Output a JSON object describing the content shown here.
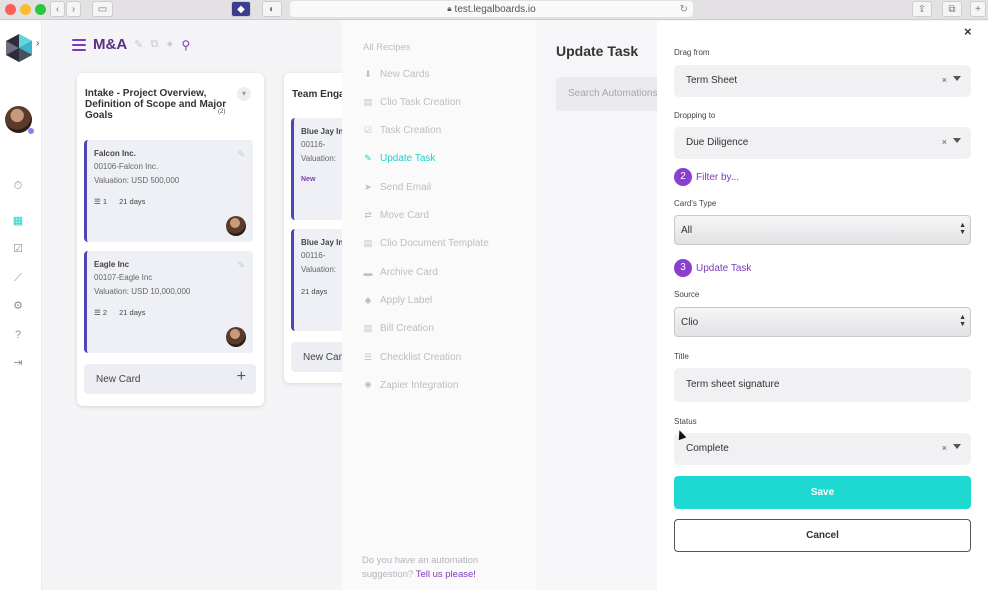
{
  "browser": {
    "url": "test.legalboards.io"
  },
  "board": {
    "title": "M&A",
    "columns": [
      {
        "title": "Intake - Project Overview, Definition of Scope and Major Goals",
        "count": "(2)",
        "cards": [
          {
            "name": "Falcon Inc.",
            "number": "00106-Falcon Inc.",
            "valuation": "Valuation: USD 500,000",
            "tasks": "1",
            "days": "21 days"
          },
          {
            "name": "Eagle Inc",
            "number": "00107-Eagle Inc",
            "valuation": "Valuation: USD 10,000,000",
            "tasks": "2",
            "days": "21 days"
          }
        ],
        "new_card": "New Card"
      },
      {
        "title": "Team Enga",
        "cards": [
          {
            "name": "Blue Jay In",
            "number": "00116-",
            "valuation": "Valuation:",
            "tag": "New"
          },
          {
            "name": "Blue Jay In",
            "number": "00116-",
            "valuation": "Valuation:",
            "days": "21 days"
          }
        ],
        "new_card": "New Car"
      }
    ]
  },
  "recipes": {
    "header": "All Recipes",
    "items": [
      {
        "label": "New Cards",
        "icon": "download-icon"
      },
      {
        "label": "Clio Task Creation",
        "icon": "document-icon"
      },
      {
        "label": "Task Creation",
        "icon": "checkbox-icon"
      },
      {
        "label": "Update Task",
        "icon": "pencil-icon",
        "active": true
      },
      {
        "label": "Send Email",
        "icon": "send-icon"
      },
      {
        "label": "Move Card",
        "icon": "arrows-icon"
      },
      {
        "label": "Clio Document Template",
        "icon": "document-icon"
      },
      {
        "label": "Archive Card",
        "icon": "archive-icon"
      },
      {
        "label": "Apply Label",
        "icon": "tags-icon"
      },
      {
        "label": "Bill Creation",
        "icon": "document-icon"
      },
      {
        "label": "Checklist Creation",
        "icon": "list-icon"
      },
      {
        "label": "Zapier Integration",
        "icon": "sun-icon"
      }
    ],
    "footer_text": "Do you have an automation suggestion?",
    "footer_link": "Tell us please!"
  },
  "middle": {
    "title": "Update Task",
    "search_placeholder": "Search Automations"
  },
  "form": {
    "drag_from_label": "Drag from",
    "drag_from_value": "Term Sheet",
    "dropping_to_label": "Dropping to",
    "dropping_to_value": "Due Diligence",
    "step2_number": "2",
    "step2_label": "Filter by...",
    "card_type_label": "Card's Type",
    "card_type_value": "All",
    "step3_number": "3",
    "step3_label": "Update Task",
    "source_label": "Source",
    "source_value": "Clio",
    "title_label": "Title",
    "title_value": "Term sheet signature",
    "status_label": "Status",
    "status_value": "Complete",
    "clear_glyph": "×",
    "save_label": "Save",
    "cancel_label": "Cancel",
    "close_glyph": "×"
  },
  "colors": {
    "accent_purple": "#7c3ab8",
    "accent_teal": "#1ed8d2",
    "card_border": "#4d45b8"
  }
}
